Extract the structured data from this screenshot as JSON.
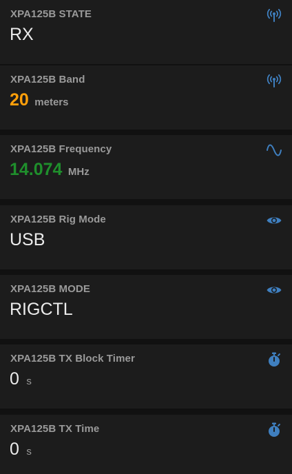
{
  "accent_color": "#3f7fbf",
  "cards": [
    {
      "label": "XPA125B STATE",
      "value": "RX",
      "unit": "",
      "icon": "antenna-icon"
    },
    {
      "label": "XPA125B Band",
      "value": "20",
      "unit": "meters",
      "value_color": "#ff9f0a",
      "icon": "antenna-icon"
    },
    {
      "label": "XPA125B Frequency",
      "value": "14.074",
      "unit": "MHz",
      "value_color": "#1f8f2c",
      "icon": "sine-wave-icon"
    },
    {
      "label": "XPA125B Rig Mode",
      "value": "USB",
      "unit": "",
      "icon": "eye-icon"
    },
    {
      "label": "XPA125B MODE",
      "value": "RIGCTL",
      "unit": "",
      "icon": "eye-icon"
    },
    {
      "label": "XPA125B TX Block Timer",
      "value": "0",
      "unit": "s",
      "icon": "stopwatch-icon"
    },
    {
      "label": "XPA125B TX Time",
      "value": "0",
      "unit": "s",
      "icon": "stopwatch-icon"
    }
  ]
}
